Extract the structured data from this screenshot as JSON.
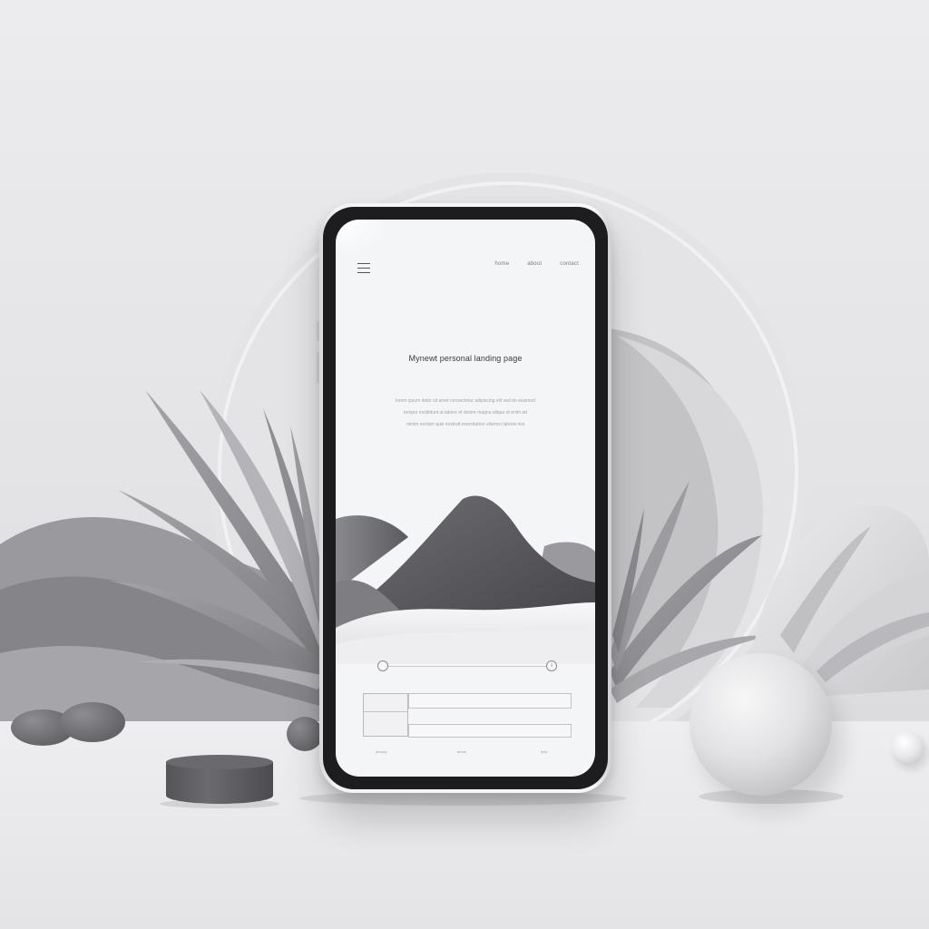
{
  "screen": {
    "menu_icon": "hamburger-menu-icon",
    "nav_links": [
      "home",
      "about",
      "contact"
    ],
    "headline": "Mynewt personal landing page",
    "body_lines": [
      "lorem ipsum dolor sit amet consectetur adipiscing elit sed do eiusmod",
      "tempor incididunt ut labore et dolore magna aliqua ut enim ad",
      "minim veniam quis nostrud exercitation ullamco laboris nisi"
    ],
    "slider_value_icon": "i",
    "footer_links": [
      "privacy",
      "terms",
      "help"
    ]
  },
  "colors": {
    "background": "#e6e6e8",
    "phone_bezel": "#1d1d20",
    "screen": "#f4f5f7",
    "puck": "#5e5e62",
    "sphere": "#dcdcde"
  }
}
